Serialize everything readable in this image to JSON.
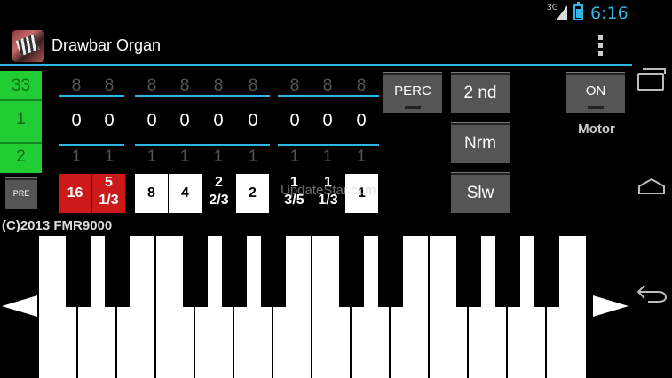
{
  "status_bar": {
    "network": "3G",
    "time": "6:16"
  },
  "app": {
    "title": "Drawbar Organ"
  },
  "drawbars": {
    "side_values": [
      "33",
      "1",
      "2"
    ],
    "top_row": [
      "8",
      "8",
      "8",
      "8",
      "8",
      "8",
      "8",
      "8",
      "8"
    ],
    "middle_row": [
      "0",
      "0",
      "0",
      "0",
      "0",
      "0",
      "0",
      "0",
      "0"
    ],
    "bottom_row": [
      "1",
      "1",
      "1",
      "1",
      "1",
      "1",
      "1",
      "1",
      "1"
    ]
  },
  "presets": {
    "pre_label": "PRE",
    "footages": [
      {
        "top": "16",
        "bottom": "",
        "style": "red"
      },
      {
        "top": "5",
        "bottom": "1/3",
        "style": "red"
      },
      {
        "top": "8",
        "bottom": "",
        "style": "white"
      },
      {
        "top": "4",
        "bottom": "",
        "style": "white"
      },
      {
        "top": "2",
        "bottom": "2/3",
        "style": "black"
      },
      {
        "top": "2",
        "bottom": "",
        "style": "white"
      },
      {
        "top": "1",
        "bottom": "3/5",
        "style": "black"
      },
      {
        "top": "1",
        "bottom": "1/3",
        "style": "black"
      },
      {
        "top": "1",
        "bottom": "",
        "style": "white"
      }
    ]
  },
  "buttons": {
    "perc": "PERC",
    "second": "2 nd",
    "normal": "Nrm",
    "slow": "Slw",
    "on": "ON",
    "motor_label": "Motor"
  },
  "watermark": "UpdateStar.com",
  "copyright": "(C)2013 FMR9000",
  "icons": {
    "app_icon": "organ-icon",
    "overflow": "overflow-menu-icon",
    "recents": "recent-apps-icon",
    "home": "home-icon",
    "back": "back-icon",
    "scroll_left": "arrow-left-icon",
    "scroll_right": "arrow-right-icon"
  },
  "colors": {
    "accent": "#33b5e5",
    "side_strip": "#22cc33",
    "preset_red": "#cc1a1a",
    "button": "#555555"
  }
}
